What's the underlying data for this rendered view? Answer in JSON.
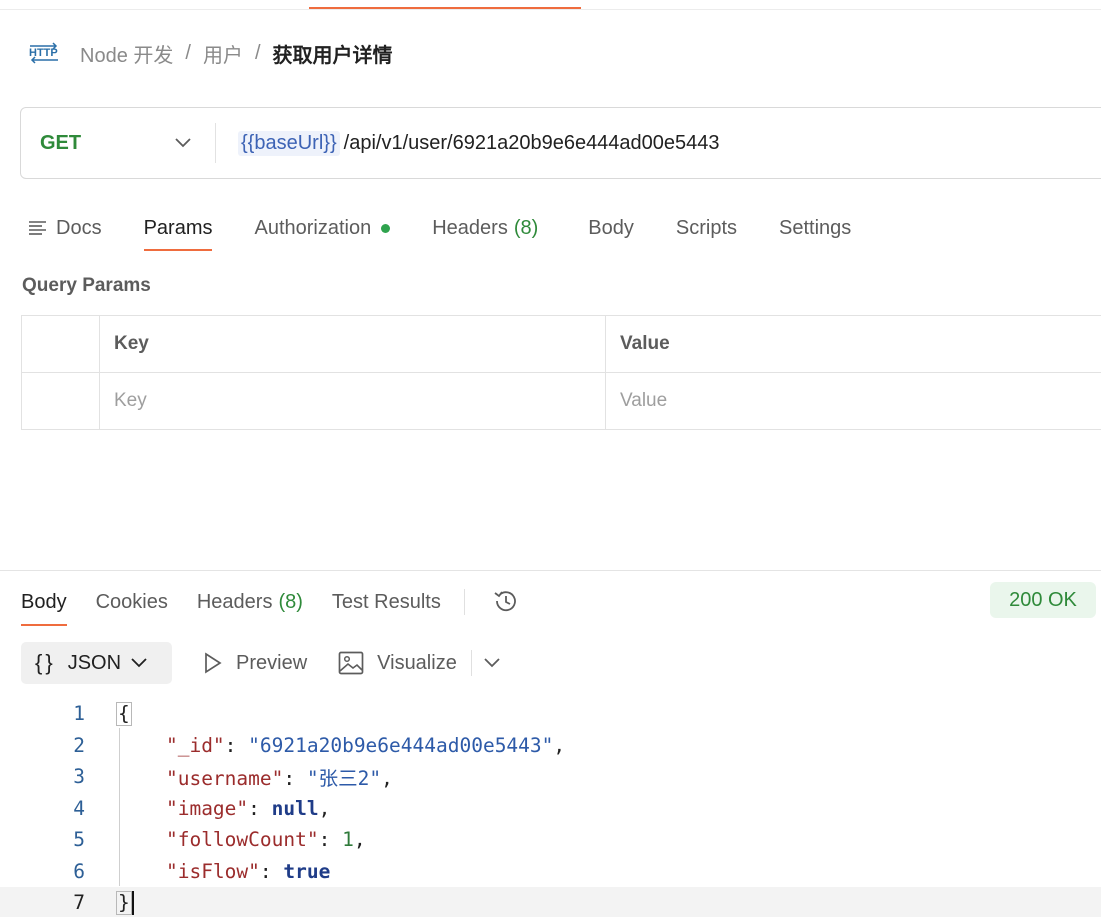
{
  "breadcrumb": {
    "icon": "http-icon",
    "collection": "Node 开发",
    "folder": "用户",
    "request": "获取用户详情",
    "separator": "/"
  },
  "request": {
    "method": "GET",
    "url_variable": "{{baseUrl}}",
    "url_path": "/api/v1/user/6921a20b9e6e444ad00e5443"
  },
  "request_tabs": [
    {
      "label": "Docs"
    },
    {
      "label": "Params"
    },
    {
      "label": "Authorization"
    },
    {
      "label": "Headers",
      "count": "(8)"
    },
    {
      "label": "Body"
    },
    {
      "label": "Scripts"
    },
    {
      "label": "Settings"
    }
  ],
  "query_params": {
    "title": "Query Params",
    "headers": {
      "key": "Key",
      "value": "Value"
    },
    "placeholders": {
      "key": "Key",
      "value": "Value"
    }
  },
  "response_tabs": [
    {
      "label": "Body"
    },
    {
      "label": "Cookies"
    },
    {
      "label": "Headers",
      "count": "(8)"
    },
    {
      "label": "Test Results"
    }
  ],
  "status": "200 OK",
  "response_toolbar": {
    "format_braces": "{}",
    "format": "JSON",
    "preview": "Preview",
    "visualize": "Visualize"
  },
  "response_body": {
    "line_numbers": [
      "1",
      "2",
      "3",
      "4",
      "5",
      "6",
      "7"
    ],
    "open_brace": "{",
    "close_brace": "}",
    "fields": [
      {
        "key": "\"_id\"",
        "value": "\"6921a20b9e6e444ad00e5443\"",
        "comma": ","
      },
      {
        "key": "\"username\"",
        "value": "\"张三2\"",
        "comma": ","
      },
      {
        "key": "\"image\"",
        "value": "null",
        "comma": ","
      },
      {
        "key": "\"followCount\"",
        "value": "1",
        "comma": ","
      },
      {
        "key": "\"isFlow\"",
        "value": "true",
        "comma": ""
      }
    ]
  },
  "colors": {
    "accent": "#ef6c3e",
    "method_get": "#2f8a3a",
    "status_ok_bg": "#eaf6ec",
    "auth_dot": "#2fa34e"
  }
}
